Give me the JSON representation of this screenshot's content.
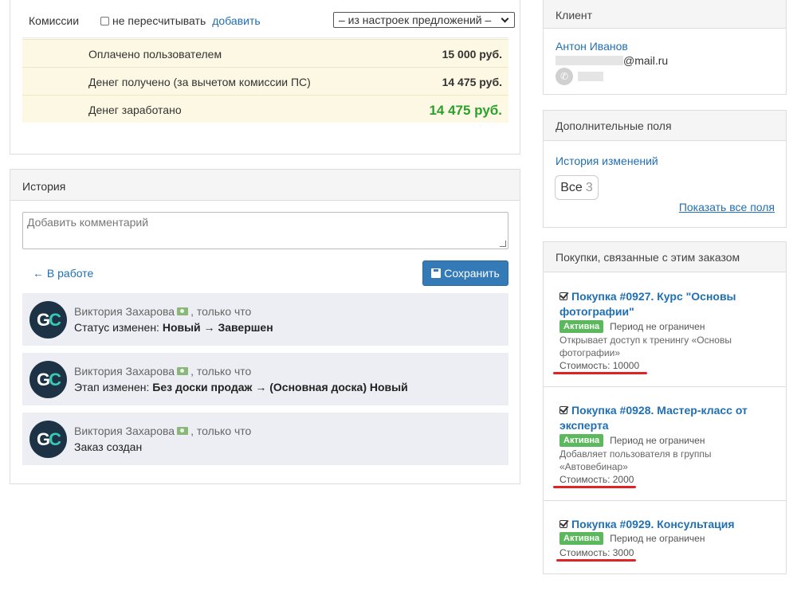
{
  "payment": {
    "commission_label": "Комиссии",
    "no_recalc_label": "не пересчитывать",
    "add_link": "добавить",
    "source_select": "– из настроек предложений –",
    "rows": [
      {
        "label": "Оплачено пользователем",
        "value": "15 000 руб."
      },
      {
        "label": "Денег получено (за вычетом комиссии ПС)",
        "value": "14 475 руб."
      },
      {
        "label": "Денег заработано",
        "value": "14 475 руб."
      }
    ]
  },
  "history": {
    "title": "История",
    "comment_placeholder": "Добавить комментарий",
    "back_link": "← В работе",
    "save_button": "Сохранить",
    "entries": [
      {
        "avatar": "GC",
        "author": "Виктория Захарова",
        "time": ", только что",
        "prefix": "Статус изменен: ",
        "detail": "Новый → Завершен"
      },
      {
        "avatar": "GC",
        "author": "Виктория Захарова",
        "time": ", только что",
        "prefix": "Этап изменен: ",
        "detail": "Без доски продаж → (Основная доска) Новый"
      },
      {
        "avatar": "GC",
        "author": "Виктория Захарова",
        "time": ", только что",
        "prefix": "Заказ создан",
        "detail": ""
      }
    ]
  },
  "client": {
    "title": "Клиент",
    "name": "Антон Иванов",
    "email_suffix": "@mail.ru"
  },
  "extra_fields": {
    "title": "Дополнительные поля",
    "history_link": "История изменений",
    "all_label": "Все",
    "all_count": "3",
    "show_all": "Показать все поля"
  },
  "purchases": {
    "title": "Покупки, связанные с этим заказом",
    "items": [
      {
        "title": "Покупка #0927. Курс \"Основы фотографии\"",
        "status": "Активна",
        "period": "Период не ограничен",
        "desc": "Открывает доступ к тренингу «Основы фотографии»",
        "cost": "Стоимость: 10000"
      },
      {
        "title": "Покупка #0928. Мастер-класс от эксперта",
        "status": "Активна",
        "period": "Период не ограничен",
        "desc": "Добавляет пользователя в группы «Автовебинар»",
        "cost": "Стоимость: 2000"
      },
      {
        "title": "Покупка #0929. Консультация",
        "status": "Активна",
        "period": "Период не ограничен",
        "desc": "",
        "cost": "Стоимость: 3000"
      }
    ]
  },
  "colors": {
    "accent": "#337ab7",
    "earned": "#2ba12b",
    "badge": "#5cb85c",
    "highlight": "#e02424",
    "summary_bg": "#fcf8e3"
  }
}
